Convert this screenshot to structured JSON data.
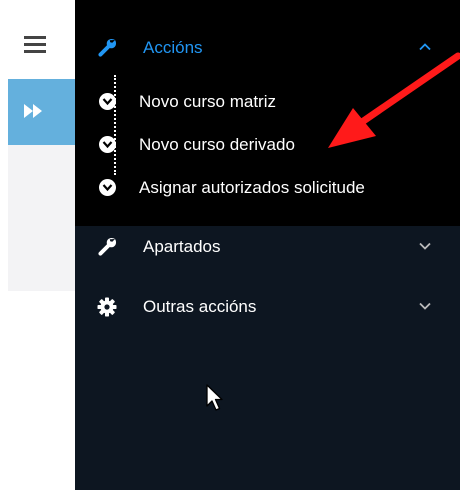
{
  "menu": {
    "acciones": {
      "label": "Accións"
    },
    "subitems": [
      {
        "label": "Novo curso matriz"
      },
      {
        "label": "Novo curso derivado"
      },
      {
        "label": "Asignar autorizados solicitude"
      }
    ],
    "apartados": {
      "label": "Apartados"
    },
    "outras": {
      "label": "Outras accións"
    }
  },
  "icons": {
    "hamburger": "menu-icon",
    "expand": "fast-forward-icon",
    "acciones": "wrench-icon",
    "apartados": "wrench-icon",
    "outras": "gear-icon",
    "subitem": "chevron-circle-down-icon"
  },
  "colors": {
    "sidebar_bg": "#0d1621",
    "open_section_bg": "#000000",
    "active_text": "#2196f3",
    "expand_button": "#64b0dd",
    "annotation_arrow": "#ff1a1a"
  }
}
